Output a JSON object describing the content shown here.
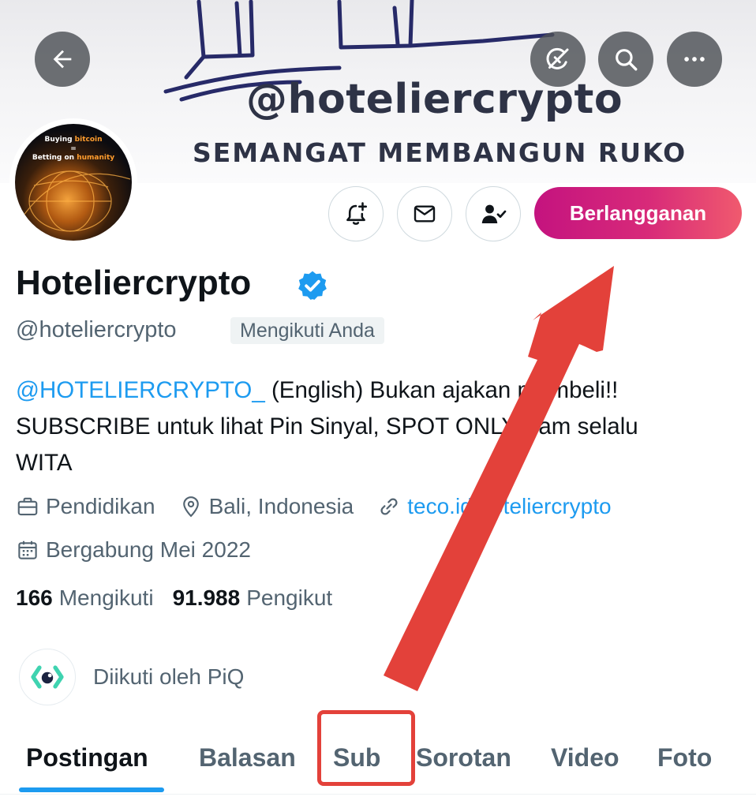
{
  "banner": {
    "handle": "@hoteliercrypto",
    "motto": "SEMANGAT MEMBANGUN RUKO"
  },
  "top_bar": {
    "back_icon": "arrow-left-icon",
    "grok_icon": "grok-icon",
    "search_icon": "search-icon",
    "more_icon": "more-horizontal-icon"
  },
  "avatar": {
    "line1_a": "Buying ",
    "line1_b": "bitcoin",
    "line2": "=",
    "line3_a": "Betting on ",
    "line3_b": "humanity"
  },
  "actions": {
    "notify_icon": "bell-plus-icon",
    "message_icon": "envelope-icon",
    "following_icon": "person-check-icon",
    "subscribe_label": "Berlangganan"
  },
  "profile": {
    "display_name": "Hoteliercrypto",
    "handle": "@hoteliercrypto",
    "follows_you": "Mengikuti Anda",
    "bio_mention": "@HOTELIERCRYPTO_",
    "bio_line1_rest": " (English) Bukan ajakan membeli!!",
    "bio_line2": "SUBSCRIBE untuk lihat Pin Sinyal, SPOT ONLY. Jam selalu",
    "bio_line3": "WITA",
    "category": "Pendidikan",
    "location": "Bali, Indonesia",
    "website": "teco.id/hoteliercrypto",
    "joined": "Bergabung Mei 2022"
  },
  "stats": {
    "following_count": "166",
    "following_label": "Mengikuti",
    "followers_count": "91.988",
    "followers_label": "Pengikut"
  },
  "followed_by": {
    "text": "Diikuti oleh PiQ"
  },
  "tabs": [
    {
      "label": "Postingan",
      "active": true
    },
    {
      "label": "Balasan",
      "active": false
    },
    {
      "label": "Sub",
      "active": false
    },
    {
      "label": "Sorotan",
      "active": false
    },
    {
      "label": "Video",
      "active": false
    },
    {
      "label": "Foto",
      "active": false
    }
  ],
  "colors": {
    "accent": "#1d9bf0",
    "subscribe_gradient_start": "#c4137f",
    "subscribe_gradient_end": "#f05a6e",
    "annotation": "#e3413a"
  }
}
